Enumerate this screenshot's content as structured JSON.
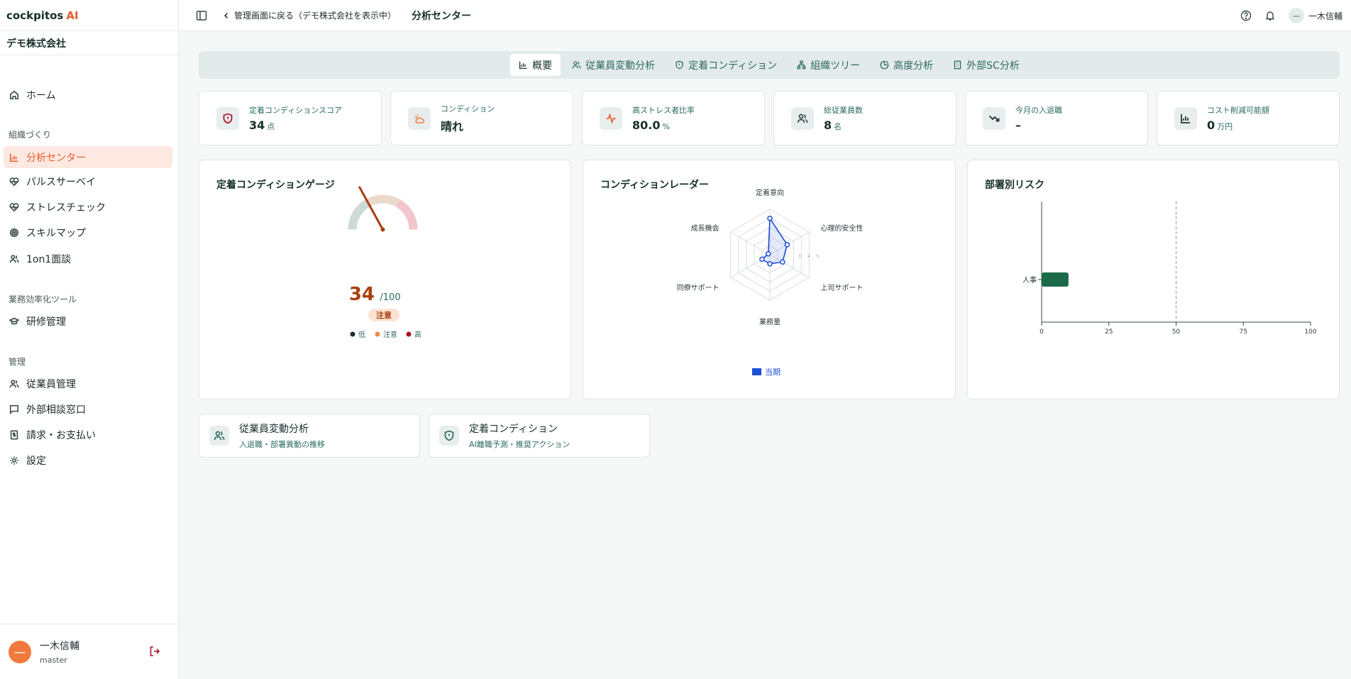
{
  "app": {
    "logo_main": "cockpitos",
    "logo_accent": "AI",
    "company": "デモ株式会社"
  },
  "sidebar": {
    "home": "ホーム",
    "section_org": "組織づくり",
    "analysis": "分析センター",
    "pulse": "パルスサーベイ",
    "stress": "ストレスチェック",
    "skill": "スキルマップ",
    "oneonone": "1on1面談",
    "section_efficiency": "業務効率化ツール",
    "training": "研修管理",
    "section_admin": "管理",
    "employees": "従業員管理",
    "consult": "外部相談窓口",
    "billing": "請求・お支払い",
    "settings": "設定"
  },
  "user": {
    "avatar": "一",
    "name": "一木信輔",
    "role": "master"
  },
  "header": {
    "back": "管理画面に戻る（デモ株式会社を表示中）",
    "title": "分析センター",
    "user_avatar": "一",
    "user_name": "一木信輔"
  },
  "tabs": {
    "overview": "概要",
    "movement": "従業員変動分析",
    "condition": "定着コンディション",
    "tree": "組織ツリー",
    "advanced": "高度分析",
    "external": "外部SC分析"
  },
  "kpis": {
    "score": {
      "label": "定着コンディションスコア",
      "value": "34",
      "unit": "点"
    },
    "condition": {
      "label": "コンディション",
      "value": "晴れ"
    },
    "stress": {
      "label": "高ストレス者比率",
      "value": "80.0",
      "unit": "%"
    },
    "headcount": {
      "label": "総従業員数",
      "value": "8",
      "unit": "名"
    },
    "joinleave": {
      "label": "今月の入退職",
      "value": "–"
    },
    "cost": {
      "label": "コスト削減可能額",
      "value": "0",
      "unit": "万円"
    }
  },
  "gauge_panel": {
    "title": "定着コンディションゲージ",
    "value": 34,
    "value_text": "34",
    "max_text": "/100",
    "status": "注意",
    "legend": [
      "低",
      "注意",
      "高"
    ],
    "colors": {
      "low": "#16302b",
      "mid": "#f08a4b",
      "high": "#a8112a",
      "needle": "#a8400e"
    }
  },
  "radar_panel": {
    "title": "コンディションレーダー",
    "legend": "当期",
    "color": "#1d4fd8"
  },
  "risk_panel": {
    "title": "部署別リスク",
    "color": "#1b6b48"
  },
  "chart_data": [
    {
      "type": "radar",
      "axes": [
        "定着意向",
        "心理的安全性",
        "上司サポート",
        "業務量",
        "同僚サポート",
        "成長機会"
      ],
      "max": 5,
      "tick_labels": [
        "5",
        "4",
        "3"
      ],
      "series": [
        {
          "name": "当期",
          "values": [
            4,
            2.2,
            1.6,
            1,
            1,
            0.2
          ]
        }
      ]
    },
    {
      "type": "bar",
      "orientation": "horizontal",
      "categories": [
        "人事"
      ],
      "values": [
        10
      ],
      "xlim": [
        0,
        100
      ],
      "xticks": [
        "0",
        "25",
        "50",
        "75",
        "100"
      ],
      "reference_line": 50
    }
  ],
  "links": {
    "movement": {
      "title": "従業員変動分析",
      "sub": "入退職・部署異動の推移"
    },
    "condition": {
      "title": "定着コンディション",
      "sub": "AI離職予測・推奨アクション"
    }
  }
}
